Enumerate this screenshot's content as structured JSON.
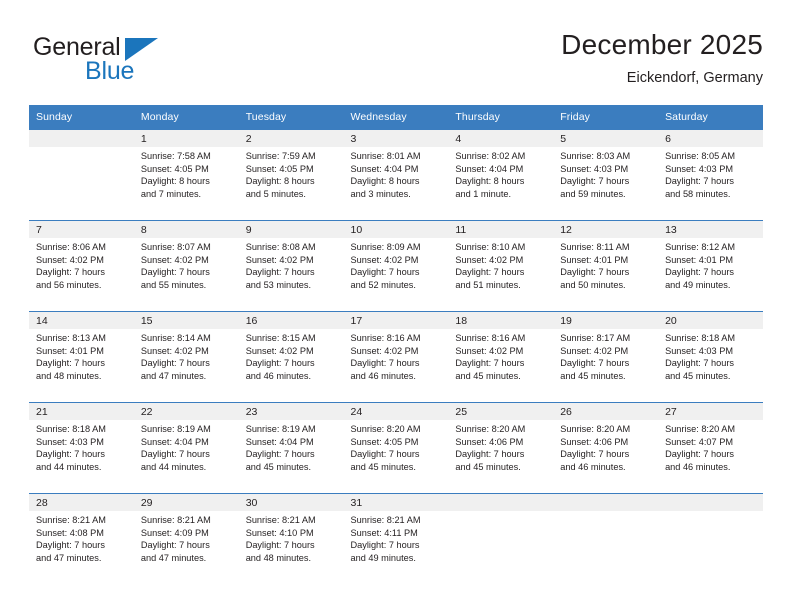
{
  "brand": {
    "name_top": "General",
    "name_bottom": "Blue",
    "triangle_icon": "triangle-logo-icon",
    "accent_color": "#1b75bc"
  },
  "header": {
    "title": "December 2025",
    "subtitle": "Eickendorf, Germany"
  },
  "calendar": {
    "header_bg": "#3b7dbf",
    "header_text_color": "#ffffff",
    "daynum_band_bg": "#f0f0f0",
    "weekdays": [
      "Sunday",
      "Monday",
      "Tuesday",
      "Wednesday",
      "Thursday",
      "Friday",
      "Saturday"
    ],
    "weeks": [
      [
        {
          "day": "",
          "sunrise": "",
          "sunset": "",
          "daylight": "",
          "daylight2": ""
        },
        {
          "day": "1",
          "sunrise": "Sunrise: 7:58 AM",
          "sunset": "Sunset: 4:05 PM",
          "daylight": "Daylight: 8 hours",
          "daylight2": "and 7 minutes."
        },
        {
          "day": "2",
          "sunrise": "Sunrise: 7:59 AM",
          "sunset": "Sunset: 4:05 PM",
          "daylight": "Daylight: 8 hours",
          "daylight2": "and 5 minutes."
        },
        {
          "day": "3",
          "sunrise": "Sunrise: 8:01 AM",
          "sunset": "Sunset: 4:04 PM",
          "daylight": "Daylight: 8 hours",
          "daylight2": "and 3 minutes."
        },
        {
          "day": "4",
          "sunrise": "Sunrise: 8:02 AM",
          "sunset": "Sunset: 4:04 PM",
          "daylight": "Daylight: 8 hours",
          "daylight2": "and 1 minute."
        },
        {
          "day": "5",
          "sunrise": "Sunrise: 8:03 AM",
          "sunset": "Sunset: 4:03 PM",
          "daylight": "Daylight: 7 hours",
          "daylight2": "and 59 minutes."
        },
        {
          "day": "6",
          "sunrise": "Sunrise: 8:05 AM",
          "sunset": "Sunset: 4:03 PM",
          "daylight": "Daylight: 7 hours",
          "daylight2": "and 58 minutes."
        }
      ],
      [
        {
          "day": "7",
          "sunrise": "Sunrise: 8:06 AM",
          "sunset": "Sunset: 4:02 PM",
          "daylight": "Daylight: 7 hours",
          "daylight2": "and 56 minutes."
        },
        {
          "day": "8",
          "sunrise": "Sunrise: 8:07 AM",
          "sunset": "Sunset: 4:02 PM",
          "daylight": "Daylight: 7 hours",
          "daylight2": "and 55 minutes."
        },
        {
          "day": "9",
          "sunrise": "Sunrise: 8:08 AM",
          "sunset": "Sunset: 4:02 PM",
          "daylight": "Daylight: 7 hours",
          "daylight2": "and 53 minutes."
        },
        {
          "day": "10",
          "sunrise": "Sunrise: 8:09 AM",
          "sunset": "Sunset: 4:02 PM",
          "daylight": "Daylight: 7 hours",
          "daylight2": "and 52 minutes."
        },
        {
          "day": "11",
          "sunrise": "Sunrise: 8:10 AM",
          "sunset": "Sunset: 4:02 PM",
          "daylight": "Daylight: 7 hours",
          "daylight2": "and 51 minutes."
        },
        {
          "day": "12",
          "sunrise": "Sunrise: 8:11 AM",
          "sunset": "Sunset: 4:01 PM",
          "daylight": "Daylight: 7 hours",
          "daylight2": "and 50 minutes."
        },
        {
          "day": "13",
          "sunrise": "Sunrise: 8:12 AM",
          "sunset": "Sunset: 4:01 PM",
          "daylight": "Daylight: 7 hours",
          "daylight2": "and 49 minutes."
        }
      ],
      [
        {
          "day": "14",
          "sunrise": "Sunrise: 8:13 AM",
          "sunset": "Sunset: 4:01 PM",
          "daylight": "Daylight: 7 hours",
          "daylight2": "and 48 minutes."
        },
        {
          "day": "15",
          "sunrise": "Sunrise: 8:14 AM",
          "sunset": "Sunset: 4:02 PM",
          "daylight": "Daylight: 7 hours",
          "daylight2": "and 47 minutes."
        },
        {
          "day": "16",
          "sunrise": "Sunrise: 8:15 AM",
          "sunset": "Sunset: 4:02 PM",
          "daylight": "Daylight: 7 hours",
          "daylight2": "and 46 minutes."
        },
        {
          "day": "17",
          "sunrise": "Sunrise: 8:16 AM",
          "sunset": "Sunset: 4:02 PM",
          "daylight": "Daylight: 7 hours",
          "daylight2": "and 46 minutes."
        },
        {
          "day": "18",
          "sunrise": "Sunrise: 8:16 AM",
          "sunset": "Sunset: 4:02 PM",
          "daylight": "Daylight: 7 hours",
          "daylight2": "and 45 minutes."
        },
        {
          "day": "19",
          "sunrise": "Sunrise: 8:17 AM",
          "sunset": "Sunset: 4:02 PM",
          "daylight": "Daylight: 7 hours",
          "daylight2": "and 45 minutes."
        },
        {
          "day": "20",
          "sunrise": "Sunrise: 8:18 AM",
          "sunset": "Sunset: 4:03 PM",
          "daylight": "Daylight: 7 hours",
          "daylight2": "and 45 minutes."
        }
      ],
      [
        {
          "day": "21",
          "sunrise": "Sunrise: 8:18 AM",
          "sunset": "Sunset: 4:03 PM",
          "daylight": "Daylight: 7 hours",
          "daylight2": "and 44 minutes."
        },
        {
          "day": "22",
          "sunrise": "Sunrise: 8:19 AM",
          "sunset": "Sunset: 4:04 PM",
          "daylight": "Daylight: 7 hours",
          "daylight2": "and 44 minutes."
        },
        {
          "day": "23",
          "sunrise": "Sunrise: 8:19 AM",
          "sunset": "Sunset: 4:04 PM",
          "daylight": "Daylight: 7 hours",
          "daylight2": "and 45 minutes."
        },
        {
          "day": "24",
          "sunrise": "Sunrise: 8:20 AM",
          "sunset": "Sunset: 4:05 PM",
          "daylight": "Daylight: 7 hours",
          "daylight2": "and 45 minutes."
        },
        {
          "day": "25",
          "sunrise": "Sunrise: 8:20 AM",
          "sunset": "Sunset: 4:06 PM",
          "daylight": "Daylight: 7 hours",
          "daylight2": "and 45 minutes."
        },
        {
          "day": "26",
          "sunrise": "Sunrise: 8:20 AM",
          "sunset": "Sunset: 4:06 PM",
          "daylight": "Daylight: 7 hours",
          "daylight2": "and 46 minutes."
        },
        {
          "day": "27",
          "sunrise": "Sunrise: 8:20 AM",
          "sunset": "Sunset: 4:07 PM",
          "daylight": "Daylight: 7 hours",
          "daylight2": "and 46 minutes."
        }
      ],
      [
        {
          "day": "28",
          "sunrise": "Sunrise: 8:21 AM",
          "sunset": "Sunset: 4:08 PM",
          "daylight": "Daylight: 7 hours",
          "daylight2": "and 47 minutes."
        },
        {
          "day": "29",
          "sunrise": "Sunrise: 8:21 AM",
          "sunset": "Sunset: 4:09 PM",
          "daylight": "Daylight: 7 hours",
          "daylight2": "and 47 minutes."
        },
        {
          "day": "30",
          "sunrise": "Sunrise: 8:21 AM",
          "sunset": "Sunset: 4:10 PM",
          "daylight": "Daylight: 7 hours",
          "daylight2": "and 48 minutes."
        },
        {
          "day": "31",
          "sunrise": "Sunrise: 8:21 AM",
          "sunset": "Sunset: 4:11 PM",
          "daylight": "Daylight: 7 hours",
          "daylight2": "and 49 minutes."
        },
        {
          "day": "",
          "sunrise": "",
          "sunset": "",
          "daylight": "",
          "daylight2": ""
        },
        {
          "day": "",
          "sunrise": "",
          "sunset": "",
          "daylight": "",
          "daylight2": ""
        },
        {
          "day": "",
          "sunrise": "",
          "sunset": "",
          "daylight": "",
          "daylight2": ""
        }
      ]
    ]
  }
}
